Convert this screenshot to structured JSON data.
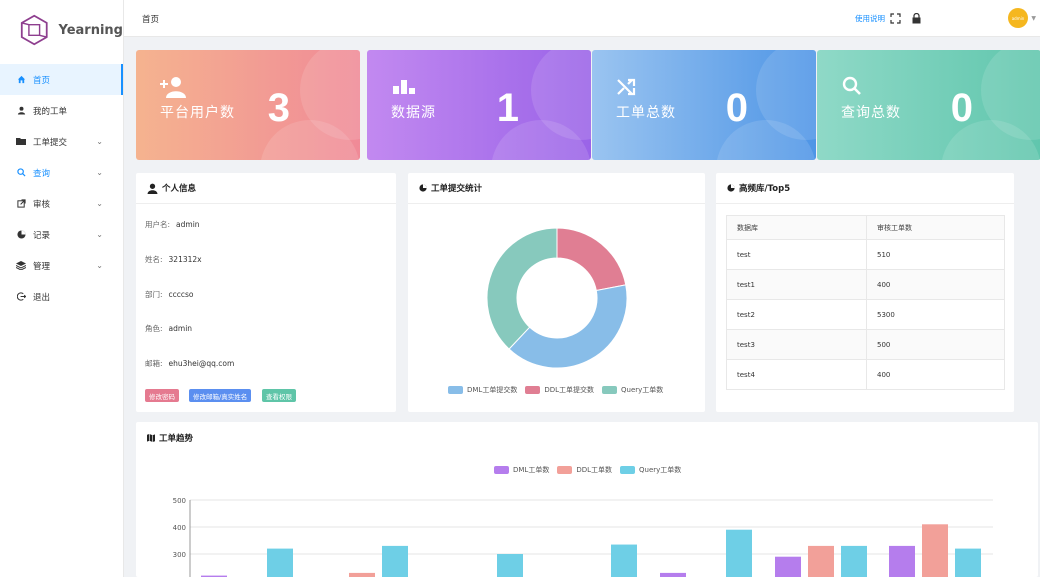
{
  "app": {
    "name": "Yearning"
  },
  "sidebar": {
    "items": [
      {
        "label": "首页",
        "icon": "home-icon"
      },
      {
        "label": "我的工单",
        "icon": "user-icon"
      },
      {
        "label": "工单提交",
        "icon": "folder-icon"
      },
      {
        "label": "查询",
        "icon": "search-icon"
      },
      {
        "label": "审核",
        "icon": "external-link-icon"
      },
      {
        "label": "记录",
        "icon": "pie-chart-icon"
      },
      {
        "label": "管理",
        "icon": "layers-icon"
      },
      {
        "label": "退出",
        "icon": "logout-icon"
      }
    ]
  },
  "header": {
    "breadcrumb": "首页",
    "help": "使用说明",
    "avatar": "admin"
  },
  "stats": [
    {
      "label": "平台用户数",
      "value": "3",
      "icon": "add-user-icon"
    },
    {
      "label": "数据源",
      "value": "1",
      "icon": "bar-chart-icon"
    },
    {
      "label": "工单总数",
      "value": "0",
      "icon": "shuffle-icon"
    },
    {
      "label": "查询总数",
      "value": "0",
      "icon": "search-icon"
    }
  ],
  "profile": {
    "title": "个人信息",
    "rows": [
      {
        "label": "用户名:",
        "value": "admin"
      },
      {
        "label": "姓名:",
        "value": "321312x"
      },
      {
        "label": "部门:",
        "value": "ccccso"
      },
      {
        "label": "角色:",
        "value": "admin"
      },
      {
        "label": "邮箱:",
        "value": "ehu3hei@qq.com"
      }
    ],
    "buttons": [
      "修改密码",
      "修改邮箱/真实姓名",
      "查看权限"
    ]
  },
  "donut": {
    "title": "工单提交统计",
    "legend": [
      "DML工单提交数",
      "DDL工单提交数",
      "Query工单数"
    ]
  },
  "top5": {
    "title": "高频库/Top5",
    "columns": [
      "数据库",
      "审核工单数"
    ],
    "rows": [
      [
        "test",
        "510"
      ],
      [
        "test1",
        "400"
      ],
      [
        "test2",
        "5300"
      ],
      [
        "test3",
        "500"
      ],
      [
        "test4",
        "400"
      ]
    ]
  },
  "trend": {
    "title": "工单趋势",
    "legend": [
      "DML工单数",
      "DDL工单数",
      "Query工单数"
    ]
  },
  "colors": {
    "dml": "#b57ded",
    "ddl": "#f2a099",
    "query": "#6ecfe6",
    "donut_dml": "#88bde8",
    "donut_ddl": "#e07e93",
    "donut_query": "#87c9bd"
  },
  "chart_data": [
    {
      "type": "pie",
      "categories": [
        "DML工单提交数",
        "DDL工单提交数",
        "Query工单数"
      ],
      "values": [
        40,
        22,
        38
      ],
      "donut": true
    },
    {
      "type": "bar",
      "ylim": [
        0,
        500
      ],
      "yticks": [
        300,
        400,
        500
      ],
      "series": [
        {
          "name": "DML工单数",
          "values": [
            220,
            0,
            230,
            290,
            330,
            310
          ]
        },
        {
          "name": "DDL工单数",
          "values": [
            0,
            230,
            0,
            0,
            330,
            410
          ]
        },
        {
          "name": "Query工单数",
          "values": [
            320,
            330,
            300,
            335,
            390,
            330,
            320
          ]
        }
      ]
    }
  ]
}
